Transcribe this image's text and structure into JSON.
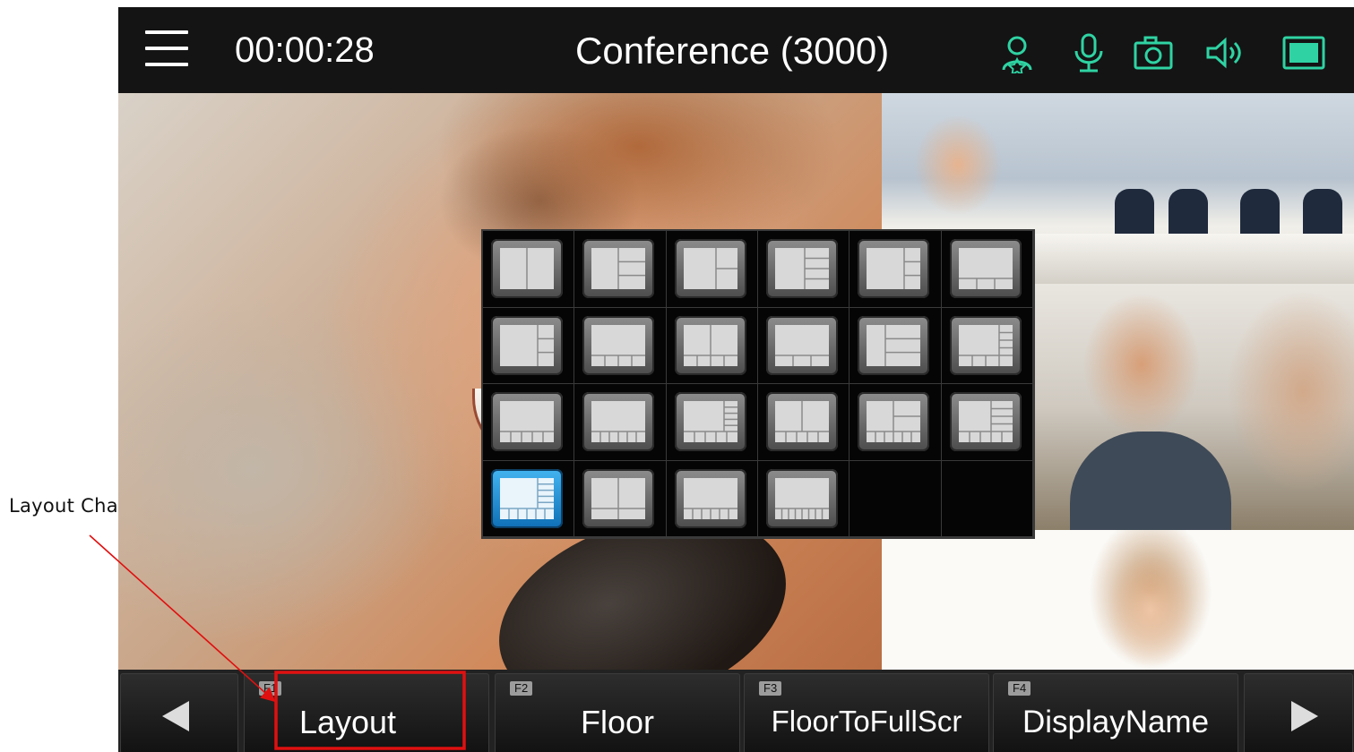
{
  "annotation": {
    "label": "Layout Change",
    "color": "#e01010"
  },
  "topbar": {
    "timer": "00:00:28",
    "title": "Conference (3000)",
    "icons": [
      "participants-icon",
      "microphone-icon",
      "camera-icon",
      "speaker-icon",
      "screen-icon"
    ],
    "accent_color": "#2fd3a3"
  },
  "layout_picker": {
    "columns": 6,
    "rows": 4,
    "selected_index": 18,
    "layout_count": 22
  },
  "toolbar": {
    "prev_label": "◀",
    "next_label": "▶",
    "buttons": [
      {
        "fkey": "F1",
        "label": "Layout"
      },
      {
        "fkey": "F2",
        "label": "Floor"
      },
      {
        "fkey": "F3",
        "label": "FloorToFullScr"
      },
      {
        "fkey": "F4",
        "label": "DisplayName"
      }
    ]
  }
}
